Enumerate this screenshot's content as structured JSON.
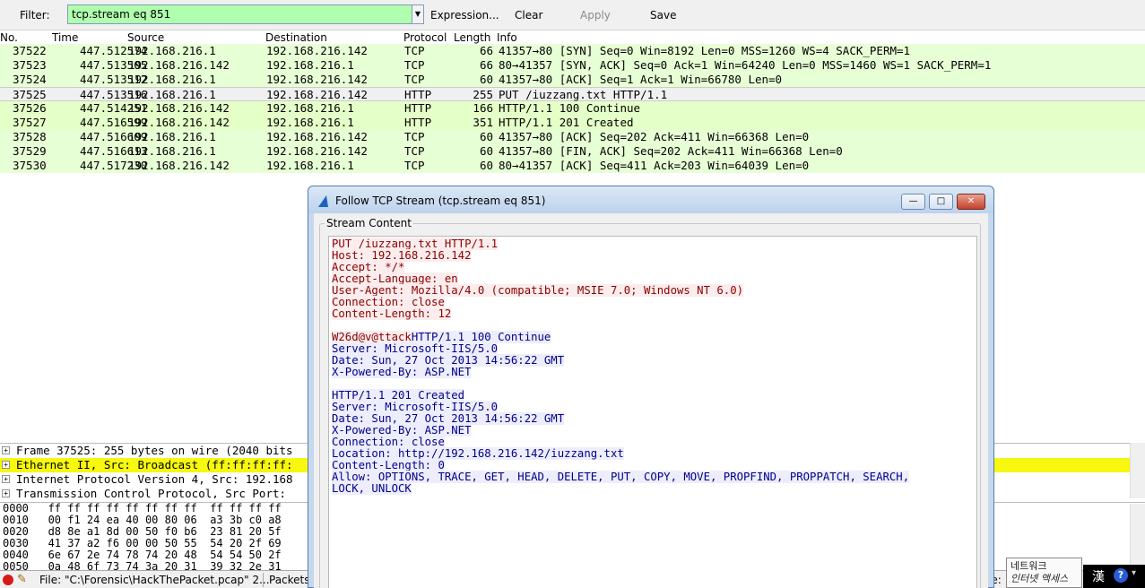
{
  "toolbar": {
    "filter_label": "Filter:",
    "filter_value": "tcp.stream eq 851",
    "dropdown_glyph": "▼",
    "expression_label": "Expression...",
    "clear_label": "Clear",
    "apply_label": "Apply",
    "save_label": "Save"
  },
  "packet_list": {
    "columns": [
      "No.",
      "Time",
      "Source",
      "Destination",
      "Protocol",
      "Length",
      "Info"
    ],
    "rows": [
      {
        "no": "37522",
        "time": "447.512574",
        "src": "192.168.216.1",
        "dst": "192.168.216.142",
        "proto": "TCP",
        "len": "66",
        "info": "41357→80 [SYN] Seq=0 Win=8192 Len=0 MSS=1260 WS=4 SACK_PERM=1"
      },
      {
        "no": "37523",
        "time": "447.513505",
        "src": "192.168.216.142",
        "dst": "192.168.216.1",
        "proto": "TCP",
        "len": "66",
        "info": "80→41357 [SYN, ACK] Seq=0 Ack=1 Win=64240 Len=0 MSS=1460 WS=1 SACK_PERM=1"
      },
      {
        "no": "37524",
        "time": "447.513512",
        "src": "192.168.216.1",
        "dst": "192.168.216.142",
        "proto": "TCP",
        "len": "60",
        "info": "41357→80 [ACK] Seq=1 Ack=1 Win=66780 Len=0"
      },
      {
        "no": "37525",
        "time": "447.513516",
        "src": "192.168.216.1",
        "dst": "192.168.216.142",
        "proto": "HTTP",
        "len": "255",
        "info": "PUT /iuzzang.txt HTTP/1.1"
      },
      {
        "no": "37526",
        "time": "447.514251",
        "src": "192.168.216.142",
        "dst": "192.168.216.1",
        "proto": "HTTP",
        "len": "166",
        "info": "HTTP/1.1 100 Continue"
      },
      {
        "no": "37527",
        "time": "447.516599",
        "src": "192.168.216.142",
        "dst": "192.168.216.1",
        "proto": "HTTP",
        "len": "351",
        "info": "HTTP/1.1 201 Created"
      },
      {
        "no": "37528",
        "time": "447.516609",
        "src": "192.168.216.1",
        "dst": "192.168.216.142",
        "proto": "TCP",
        "len": "60",
        "info": "41357→80 [ACK] Seq=202 Ack=411 Win=66368 Len=0"
      },
      {
        "no": "37529",
        "time": "447.516613",
        "src": "192.168.216.1",
        "dst": "192.168.216.142",
        "proto": "TCP",
        "len": "60",
        "info": "41357→80 [FIN, ACK] Seq=202 Ack=411 Win=66368 Len=0"
      },
      {
        "no": "37530",
        "time": "447.517230",
        "src": "192.168.216.142",
        "dst": "192.168.216.1",
        "proto": "TCP",
        "len": "60",
        "info": "80→41357 [ACK] Seq=411 Ack=203 Win=64039 Len=0"
      }
    ]
  },
  "details": {
    "expander_glyph": "+",
    "rows": [
      "Frame 37525: 255 bytes on wire (2040 bits",
      "Ethernet II, Src: Broadcast (ff:ff:ff:ff:",
      "Internet Protocol Version 4, Src: 192.168",
      "Transmission Control Protocol, Src Port:"
    ]
  },
  "hex": {
    "rows": [
      "0000   ff ff ff ff ff ff ff ff  ff ff ff ff",
      "0010   00 f1 24 ea 40 00 80 06  a3 3b c0 a8",
      "0020   d8 8e a1 8d 00 50 f0 b6  23 81 20 5f",
      "0030   41 37 a2 f6 00 00 50 55  54 20 2f 69",
      "0040   6e 67 2e 74 78 74 20 48  54 54 50 2f",
      "0050   0a 48 6f 73 74 3a 20 31  39 32 2e 31"
    ]
  },
  "statusbar": {
    "file": "File: \"C:\\Forensic\\HackThePacket.pcap\" 2...",
    "packets": "Packets:",
    "profile": "le:"
  },
  "ime": {
    "line1": "네트워크",
    "line2": "인터넷 액세스",
    "han": "漢",
    "help": "?",
    "menu": "▾"
  },
  "dialog": {
    "title": "Follow TCP Stream (tcp.stream eq 851)",
    "minimize": "—",
    "maximize": "□",
    "close": "✕",
    "group_label": "Stream Content",
    "client_lines": [
      "PUT /iuzzang.txt HTTP/1.1",
      "Host: 192.168.216.142",
      "Accept: */*",
      "Accept-Language: en",
      "User-Agent: Mozilla/4.0 (compatible; MSIE 7.0; Windows NT 6.0)",
      "Connection: close",
      "Content-Length: 12"
    ],
    "client_body": "W26d@v@ttack",
    "server_first": "HTTP/1.1 100 Continue",
    "server_lines_1": [
      "Server: Microsoft-IIS/5.0",
      "Date: Sun, 27 Oct 2013 14:56:22 GMT",
      "X-Powered-By: ASP.NET"
    ],
    "server_lines_2": [
      "HTTP/1.1 201 Created",
      "Server: Microsoft-IIS/5.0",
      "Date: Sun, 27 Oct 2013 14:56:22 GMT",
      "X-Powered-By: ASP.NET",
      "Connection: close",
      "Location: http://192.168.216.142/iuzzang.txt",
      "Content-Length: 0",
      "Allow: OPTIONS, TRACE, GET, HEAD, DELETE, PUT, COPY, MOVE, PROPFIND, PROPPATCH, SEARCH,",
      "LOCK, UNLOCK"
    ]
  }
}
